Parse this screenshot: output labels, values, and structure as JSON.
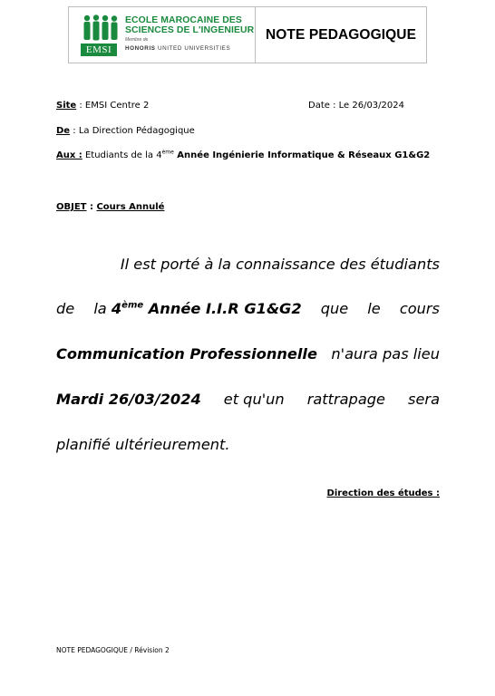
{
  "header": {
    "logo": {
      "line1": "ECOLE MAROCAINE DES",
      "line2": "SCIENCES DE L'INGENIEUR",
      "member": "Membre de",
      "group_bold": "HONORIS",
      "group_rest": "UNITED UNIVERSITIES",
      "tag": "EMSI"
    },
    "title": "NOTE PEDAGOGIQUE"
  },
  "meta": {
    "site_label": "Site",
    "site_value": " : EMSI Centre  2",
    "date": "Date : Le 26/03/2024",
    "from_label": "De",
    "from_value": " : La Direction Pédagogique",
    "to_label": "Aux :",
    "to_value_a": " Etudiants de la 4",
    "to_sup": "ème",
    "to_value_b": " Année Ingénierie Informatique & Réseaux G1&G2"
  },
  "subject": {
    "label": "OBJET",
    "sep": " : ",
    "value": "Cours Annulé"
  },
  "body": {
    "l1": "Il est porté à la connaissance des étudiants",
    "l2_w1": "de",
    "l2_w2a": "la ",
    "l2_num": "4",
    "l2_sup": "ème",
    "l2_bold": " Année I.I.R G1&G2",
    "l2_w3": "que",
    "l2_w4": "le",
    "l2_w5": "cours",
    "l3_bold": "Communication Professionnelle",
    "l3_rest": " n'aura pas lieu",
    "l4_bold": "Mardi 26/03/2024",
    "l4_w1": "et qu'un",
    "l4_w2": "rattrapage",
    "l4_w3": "sera",
    "l5": "planifié ultérieurement."
  },
  "signature": "Direction des études :",
  "footer": "NOTE PEDAGOGIQUE / Révision 2",
  "colors": {
    "brand_green": "#1a8a3e",
    "border": "#bdbdbd"
  }
}
